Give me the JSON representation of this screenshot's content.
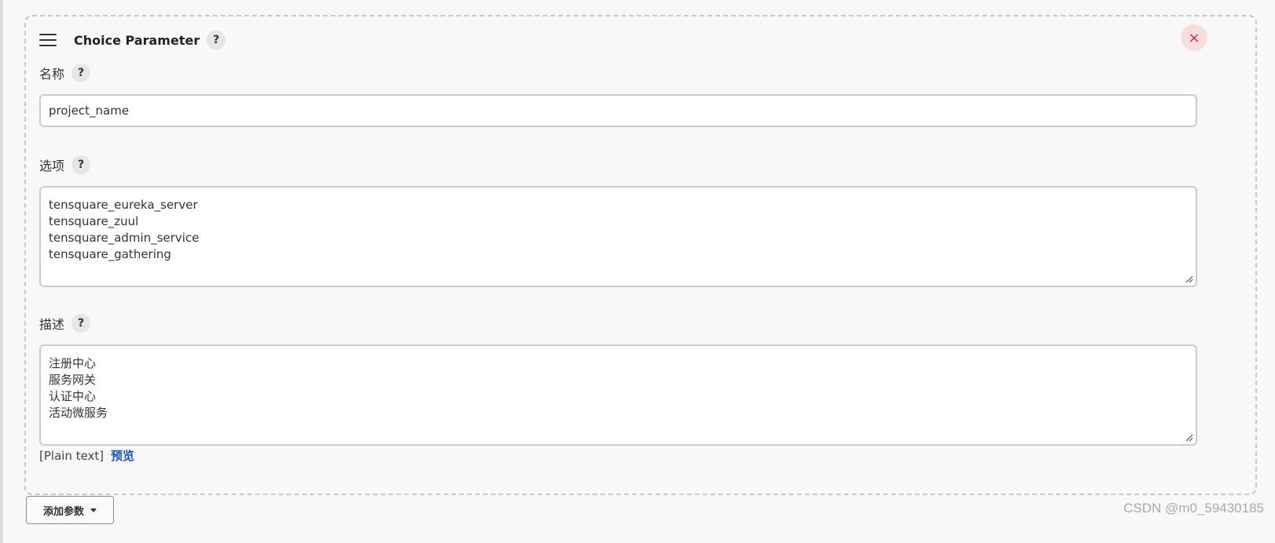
{
  "section": {
    "title": "Choice Parameter",
    "help": "?",
    "close": "×"
  },
  "name_field": {
    "label": "名称",
    "help": "?",
    "value": "project_name"
  },
  "choices_field": {
    "label": "选项",
    "help": "?",
    "lines": [
      "tensquare_eureka_server",
      "tensquare_zuul",
      "tensquare_admin_service",
      "tensquare_gathering"
    ]
  },
  "description_field": {
    "label": "描述",
    "help": "?",
    "lines": [
      "注册中心",
      "服务网关",
      "认证中心",
      "活动微服务"
    ]
  },
  "format": {
    "plain_text": "[Plain text]",
    "preview_link": "预览"
  },
  "add_param_button": "添加参数",
  "watermark": "CSDN @m0_59430185"
}
